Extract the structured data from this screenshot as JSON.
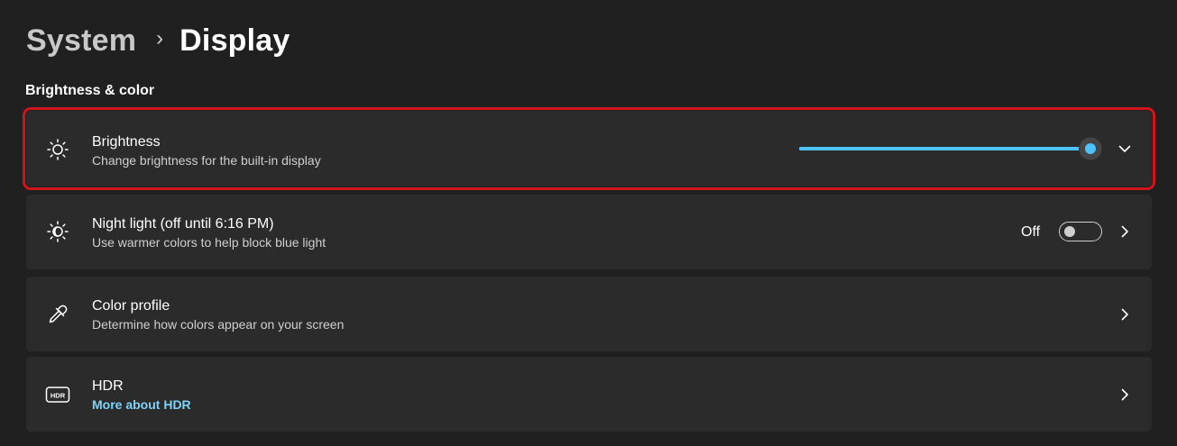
{
  "breadcrumb": {
    "parent": "System",
    "separator": "›",
    "current": "Display"
  },
  "section_title": "Brightness & color",
  "brightness": {
    "title": "Brightness",
    "subtitle": "Change brightness for the built-in display",
    "level_percent": 99
  },
  "night_light": {
    "title": "Night light (off until 6:16 PM)",
    "subtitle": "Use warmer colors to help block blue light",
    "toggle_label": "Off",
    "toggle_on": false
  },
  "color_profile": {
    "title": "Color profile",
    "subtitle": "Determine how colors appear on your screen"
  },
  "hdr": {
    "title": "HDR",
    "link": "More about HDR",
    "icon_text": "HDR"
  },
  "colors": {
    "accent": "#4cc2ff",
    "highlight": "#d1141c",
    "card": "#2b2b2b",
    "background": "#202020"
  },
  "icons": [
    "sun-icon",
    "chevron-down-icon",
    "night-light-icon",
    "chevron-right-icon",
    "eyedropper-icon",
    "hdr-icon"
  ]
}
